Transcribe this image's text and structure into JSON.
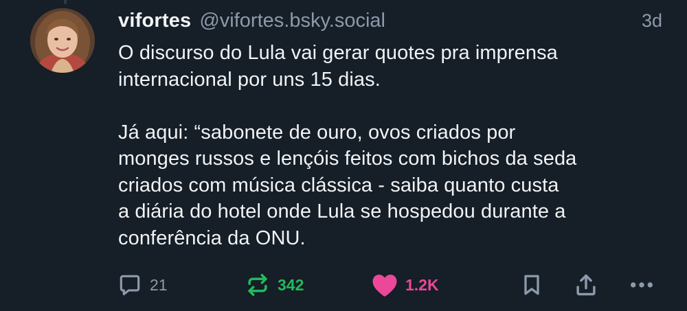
{
  "post": {
    "author": {
      "display_name": "vifortes",
      "handle": "@vifortes.bsky.social"
    },
    "timestamp": "3d",
    "text": "O discurso do Lula vai gerar quotes pra imprensa\ninternacional por uns 15 dias.\n\nJá aqui: “sabonete de ouro, ovos criados por\nmonges russos e lençóis feitos com bichos da seda\ncriados com música clássica - saiba quanto custa\na diária do hotel onde Lula se hospedou durante a\nconferência da ONU.",
    "actions": {
      "reply": {
        "icon": "reply-icon",
        "count": "21"
      },
      "repost": {
        "icon": "repost-icon",
        "count": "342"
      },
      "like": {
        "icon": "heart-icon",
        "count": "1.2K"
      },
      "bookmark": {
        "icon": "bookmark-icon"
      },
      "share": {
        "icon": "share-icon"
      },
      "more": {
        "icon": "more-icon"
      }
    }
  },
  "colors": {
    "background": "#161e27",
    "text": "#f1f3f5",
    "muted": "#8c9aab",
    "repost_active": "#20bc5c",
    "like_active": "#ec4899"
  }
}
